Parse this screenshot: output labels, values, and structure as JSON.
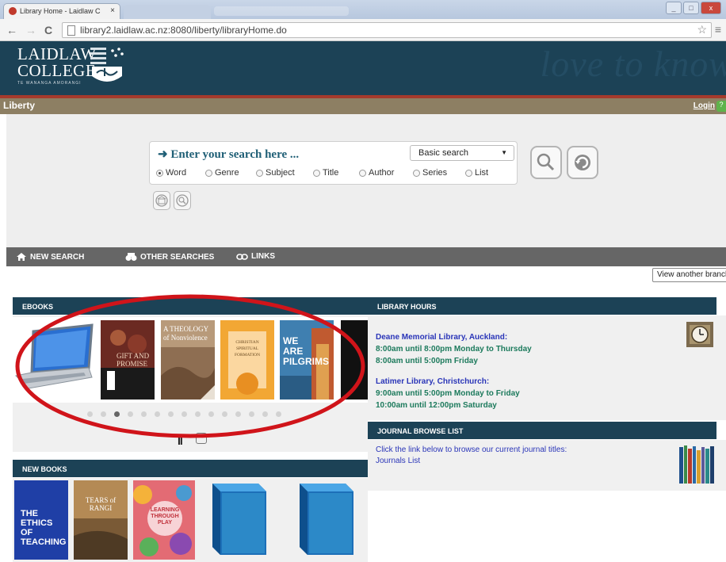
{
  "browser": {
    "tab_title": "Library Home - Laidlaw C",
    "tab_close": "×",
    "url": "library2.laidlaw.ac.nz:8080/liberty/libraryHome.do",
    "back": "←",
    "forward": "→",
    "reload": "C",
    "bookmark": "☆",
    "menu": "≡"
  },
  "header": {
    "logo_line1": "LAIDLAW",
    "logo_line2": "COLLEGE",
    "logo_subtitle": "TE WANANGA AMORANGI",
    "tagline": "love to know"
  },
  "liberty_bar": {
    "label": "Liberty",
    "login": "Login",
    "help": "?"
  },
  "search": {
    "prompt": "➜  Enter your search here ...",
    "type_selected": "Basic search",
    "radio_options": [
      {
        "label": "Word",
        "checked": true
      },
      {
        "label": "Genre",
        "checked": false
      },
      {
        "label": "Subject",
        "checked": false
      },
      {
        "label": "Title",
        "checked": false
      },
      {
        "label": "Author",
        "checked": false
      },
      {
        "label": "Series",
        "checked": false
      },
      {
        "label": "List",
        "checked": false
      }
    ]
  },
  "nav": {
    "new_search": "NEW SEARCH",
    "other_searches": "OTHER SEARCHES",
    "links": "LINKS"
  },
  "view_branch": "View another branch",
  "ebooks": {
    "title": "EBOOKS",
    "covers": [
      {
        "title": "",
        "color": "#ffffff"
      },
      {
        "title": "GIFT AND PROMISE",
        "color": "#1a1a1a"
      },
      {
        "title": "A THEOLOGY of Nonviolence",
        "color": "#b89a7a"
      },
      {
        "title": "CHRISTIAN SPIRITUAL FORMATION",
        "color": "#f2a734"
      },
      {
        "title": "WE ARE PILGRIMS",
        "color": "#3f7fb0"
      }
    ],
    "dot_count": 15,
    "active_dot": 2,
    "pause_label": "II"
  },
  "hours": {
    "title": "LIBRARY HOURS",
    "libraries": [
      {
        "name": "Deane Memorial Library, Auckland:",
        "lines": [
          "8:00am until 8:00pm Monday to Thursday",
          "8:00am until 5:00pm Friday"
        ]
      },
      {
        "name": "Latimer Library, Christchurch:",
        "lines": [
          "9:00am until 5:00pm Monday to Friday",
          "10:00am until 12:00pm Saturday"
        ]
      }
    ]
  },
  "journals": {
    "title": "JOURNAL BROWSE LIST",
    "text": "Click the link below to browse our current journal titles:",
    "link": "Journals List"
  },
  "new_books": {
    "title": "NEW BOOKS",
    "covers": [
      {
        "title": "THE ETHICS OF TEACHING",
        "color": "#1f3fa6"
      },
      {
        "title": "TEARS of RANGI",
        "color": "#b48a55"
      },
      {
        "title": "LEARNING THROUGH PLAY",
        "color": "#e36b74"
      },
      {
        "title": "",
        "color": "#2c89c8"
      },
      {
        "title": "",
        "color": "#2c89c8"
      }
    ]
  },
  "colors": {
    "header_navy": "#1c4256",
    "annotation_red": "#d0141a",
    "liberty_brown": "#8d7f63"
  }
}
